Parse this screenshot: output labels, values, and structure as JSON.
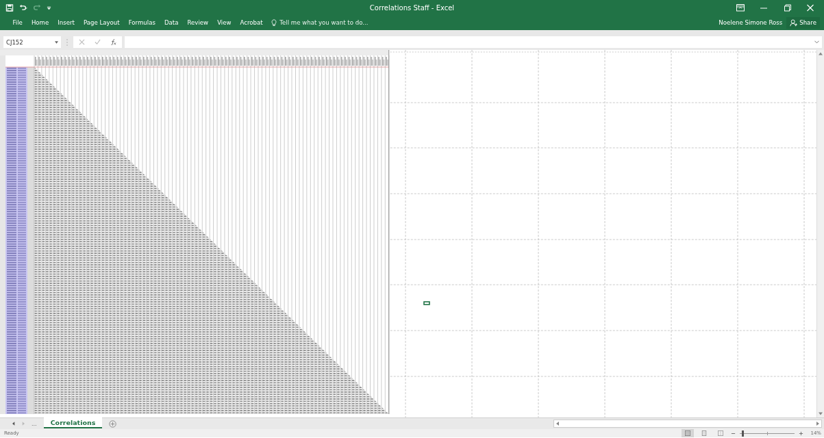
{
  "window": {
    "title": "Correlations Staff - Excel"
  },
  "ribbon_tabs": [
    {
      "label": "File",
      "selected": false
    },
    {
      "label": "Home",
      "selected": false
    },
    {
      "label": "Insert",
      "selected": false
    },
    {
      "label": "Page Layout",
      "selected": false
    },
    {
      "label": "Formulas",
      "selected": false
    },
    {
      "label": "Data",
      "selected": false
    },
    {
      "label": "Review",
      "selected": false
    },
    {
      "label": "View",
      "selected": false
    },
    {
      "label": "Acrobat",
      "selected": false
    }
  ],
  "tell_me": {
    "placeholder": "Tell me what you want to do..."
  },
  "user": "Noelene Simone Ross",
  "share": "Share",
  "name_box": "CJ152",
  "sheet_tabs": [
    {
      "label": "Correlations",
      "selected": true
    }
  ],
  "more_sheets": "...",
  "status": "Ready",
  "views": [
    {
      "kind": "normal",
      "selected": true
    },
    {
      "kind": "page_layout",
      "selected": false
    },
    {
      "kind": "page_break",
      "selected": false
    }
  ],
  "zoom": {
    "level": 0.04,
    "reading": "14%"
  }
}
